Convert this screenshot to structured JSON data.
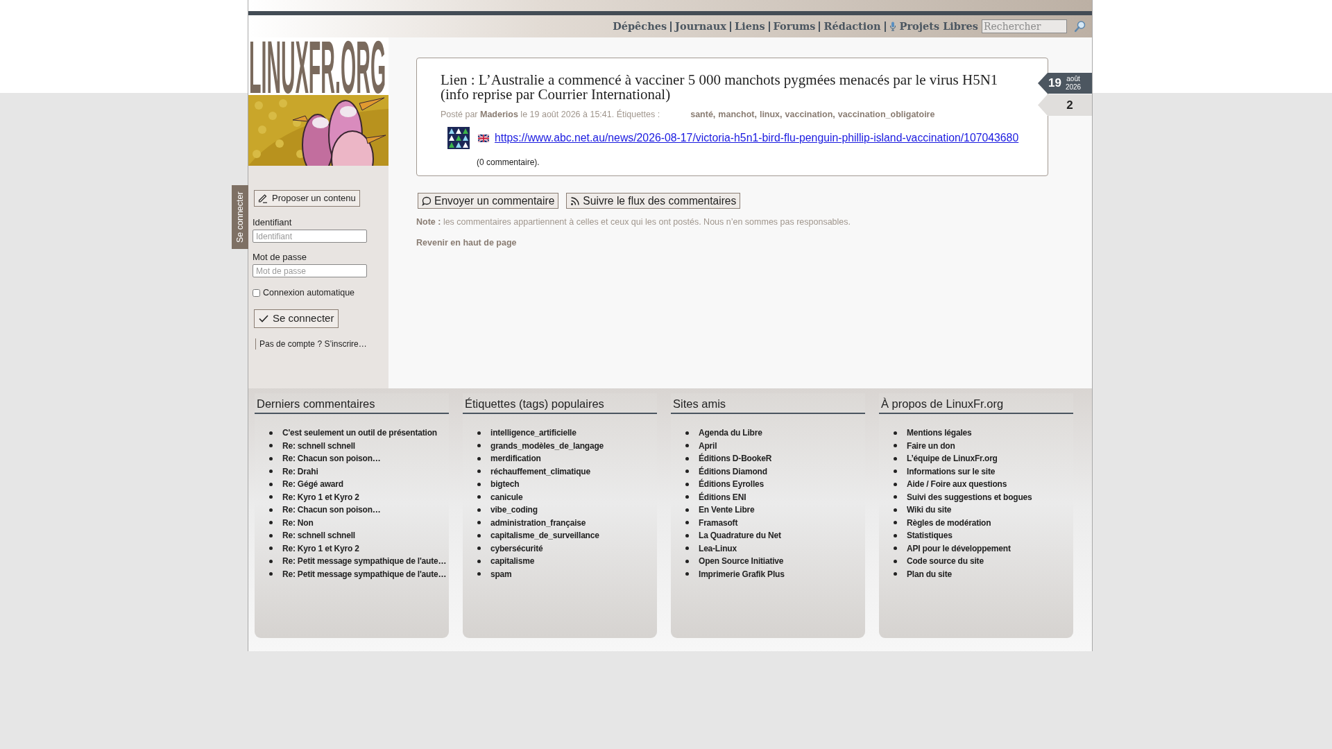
{
  "nav": {
    "links": [
      {
        "label": "Dépêches",
        "kind": "text"
      },
      {
        "label": "Journaux",
        "kind": "text"
      },
      {
        "label": "Liens",
        "kind": "text"
      },
      {
        "label": "Forums",
        "kind": "text"
      },
      {
        "label": "Rédaction",
        "kind": "text"
      },
      {
        "label": "Projets Libres",
        "kind": "icon_text"
      }
    ],
    "search": {
      "placeholder": "Rechercher"
    }
  },
  "logo": {
    "text": "LINUXFR.ORG"
  },
  "login_tab": {
    "label": "Se connecter"
  },
  "sidebar": {
    "propose_button": "Proposer un contenu",
    "fields": [
      {
        "label": "Identifiant",
        "placeholder": "Identifiant"
      },
      {
        "label": "Mot de passe",
        "placeholder": "Mot de passe"
      }
    ],
    "remember": {
      "label": "Connexion automatique",
      "checked": false
    },
    "submit": "Se connecter",
    "signup": "Pas de compte ? S’inscrire…"
  },
  "article": {
    "title": "Lien : L’Australie a commencé à vacciner 5 000 manchots pygmées menacés par le virus H5N1 (info reprise par Courrier International)",
    "date": {
      "day": "19",
      "month": "août",
      "year": "2026"
    },
    "comments_count": "2",
    "meta": {
      "prefix": "Posté par",
      "author": "Maderios",
      "posted": "le 19 août 2026 à 15:41. Étiquettes :"
    },
    "tags": [
      "santé,",
      "manchot,",
      "linux,",
      "vaccination,",
      "vaccination_obligatoire"
    ],
    "link": {
      "url": "https://www.abc.net.au/news/2026-08-17/victoria-h5n1-bird-flu-penguin-phillip-island-vaccination/107043680"
    },
    "comments": "(0 commentaire)."
  },
  "actions": [
    {
      "label": "Envoyer un commentaire",
      "kind": "comment"
    },
    {
      "label": "Suivre le flux des commentaires",
      "kind": "feed"
    }
  ],
  "note": "**Note :** les commentaires appartiennent à celles et ceux qui les ont postés. Nous n’en sommes pas responsables.",
  "back_to_top": "Revenir en haut de page",
  "footer": [
    {
      "title": "Derniers commentaires",
      "items": [
        "C'est seulement un outil de présentation",
        "Re: schnell schnell",
        "Re: Chacun son poison…",
        "Re: Drahi",
        "Re: Gégé award",
        "Re: Kyro 1 et Kyro 2",
        "Re: Chacun son poison…",
        "Re: Non",
        "Re: schnell schnell",
        "Re: Kyro 1 et Kyro 2",
        "Re: Petit message sympathique de l'aute…",
        "Re: Petit message sympathique de l'aute…"
      ]
    },
    {
      "title": "Étiquettes (tags) populaires",
      "items": [
        "intelligence_artificielle",
        "grands_modèles_de_langage",
        "merdification",
        "réchauffement_climatique",
        "bigtech",
        "canicule",
        "vibe_coding",
        "administration_française",
        "capitalisme_de_surveillance",
        "cybersécurité",
        "capitalisme",
        "spam"
      ]
    },
    {
      "title": "Sites amis",
      "items": [
        "Agenda du Libre",
        "April",
        "Éditions D-BookeR",
        "Éditions Diamond",
        "Éditions Eyrolles",
        "Éditions ENI",
        "En Vente Libre",
        "Framasoft",
        "La Quadrature du Net",
        "Lea-Linux",
        "Open Source Initiative",
        "Imprimerie Grafik Plus"
      ]
    },
    {
      "title": "À propos de LinuxFr.org",
      "items": [
        "Mentions légales",
        "Faire un don",
        "L’équipe de LinuxFr.org",
        "Informations sur le site",
        "Aide / Foire aux questions",
        "Suivi des suggestions et bogues",
        "Wiki du site",
        "Règles de modération",
        "Statistiques",
        "API pour le développement",
        "Code source du site",
        "Plan du site"
      ]
    }
  ]
}
